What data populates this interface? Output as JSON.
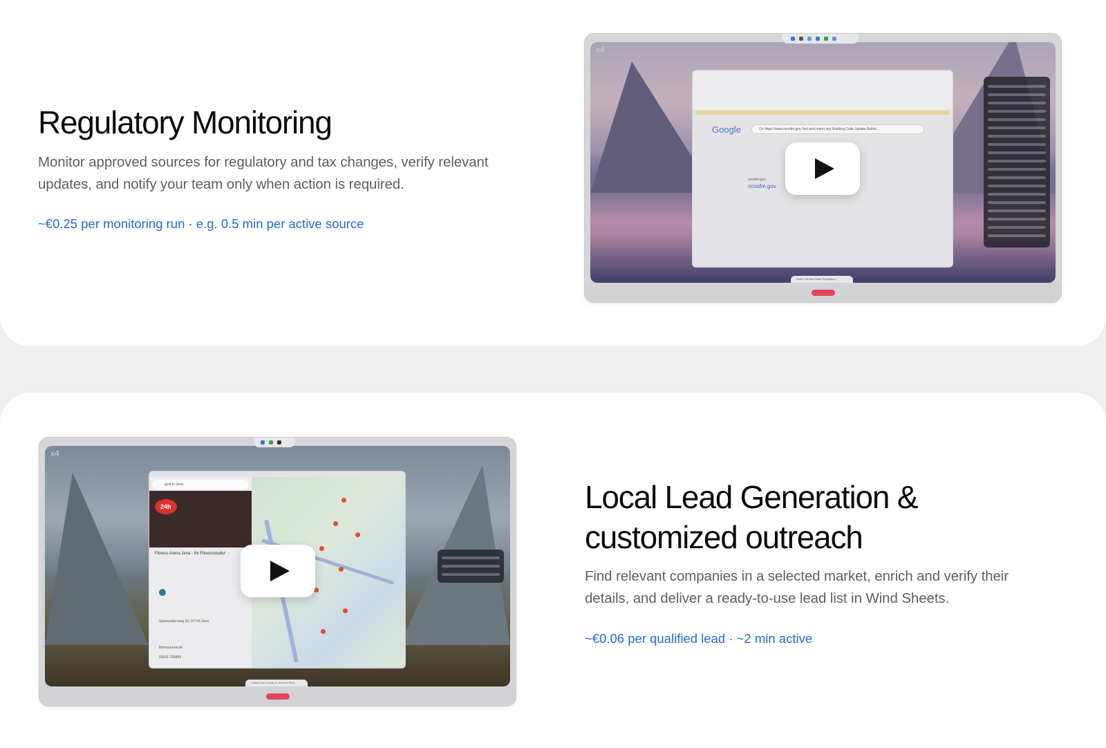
{
  "sections": [
    {
      "title": "Regulatory Monitoring",
      "description": "Monitor approved sources for regulatory and tax changes, verify relevant updates, and notify your team only when action is required.",
      "price": "~€0.25 per monitoring run",
      "separator": "·",
      "duration": "e.g. 0.5 min per active source",
      "video": {
        "corner_label": "x4",
        "google_logo": "Google",
        "search_query": "On https://www.ncosfm.gov, find and report any Building Code Update Bulleti...",
        "result_domain": "ncosfm.gov",
        "result_title": "ncosfm.gov",
        "bottom_label": "North Carolina State Regulatory...",
        "play_label": "Play video"
      }
    },
    {
      "title_line1": "Local Lead Generation &",
      "title_line2": "customized outreach",
      "description": "Find relevant companies in a selected market, enrich and verify their details, and deliver a ready-to-use lead list in Wind Sheets.",
      "price": "~€0.06 per qualified lead",
      "separator": "·",
      "duration": "~2 min active",
      "video": {
        "corner_label": "x4",
        "search_query": "gym in Jena",
        "place_name": "Fitness Arena Jena - Ihr Fitnessstudio!",
        "badge": "24h",
        "address": "Spitzweidenweg 32, 07743 Jena",
        "website": "fitnessarena.de",
        "phone": "03641 235889",
        "bottom_label": "Collect Gym Leads in Jena for Pers...",
        "play_label": "Play video"
      }
    }
  ],
  "colors": {
    "accent": "#2468d8",
    "record": "#e0445e"
  }
}
